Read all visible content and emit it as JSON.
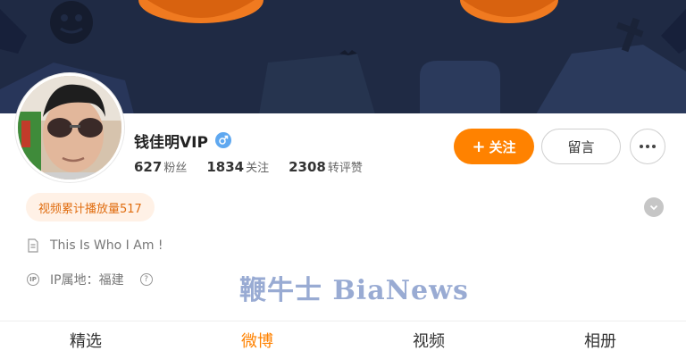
{
  "banner": {
    "theme": "halloween-pumpkins",
    "background_color": "#1f2a44",
    "accent": "#f07a20"
  },
  "profile": {
    "name": "钱佳明VIP",
    "gender_icon": "male-icon",
    "stats": [
      {
        "number": "627",
        "label": "粉丝"
      },
      {
        "number": "1834",
        "label": "关注"
      },
      {
        "number": "2308",
        "label": "转评赞"
      }
    ],
    "play_count_badge": "视频累计播放量517",
    "bio": "This Is Who I Am !",
    "ip_label": "IP属地：福建"
  },
  "actions": {
    "follow_label": "关注",
    "follow_icon": "+",
    "message_label": "留言",
    "more_icon": "more-dots-icon"
  },
  "watermark": "鞭牛士 BiaNews",
  "tabs": [
    {
      "label": "精选",
      "active": false
    },
    {
      "label": "微博",
      "active": true
    },
    {
      "label": "视频",
      "active": false
    },
    {
      "label": "相册",
      "active": false
    }
  ],
  "colors": {
    "brand_orange": "#ff8200",
    "badge_bg": "#fff1e6",
    "badge_text": "#e06d10",
    "gender_blue": "#5fa8f0"
  }
}
